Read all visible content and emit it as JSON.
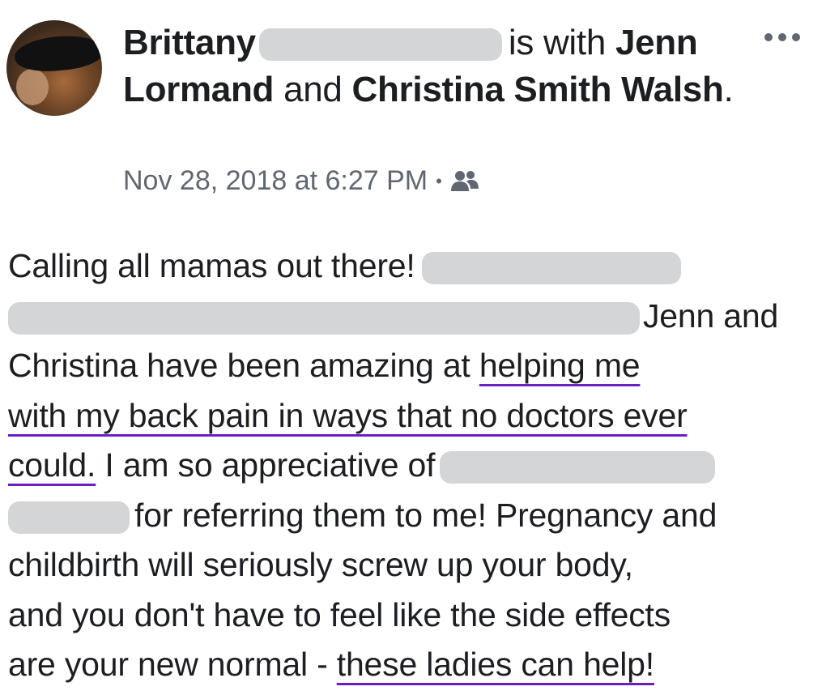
{
  "post": {
    "author_first": "Brittany",
    "is_with": "is with",
    "tagged_1_part1": "Jenn",
    "tagged_1_part2": "Lormand",
    "and": "and",
    "tagged_2_part1": "Christina Smith",
    "tagged_2_part2": "Walsh",
    "period": ".",
    "timestamp": "Nov 28, 2018 at 6:27 PM",
    "separator": "•",
    "privacy_icon": "friends-icon",
    "more_icon": "more-options-icon"
  },
  "body": {
    "l1": "Calling all mamas out there!",
    "l2": "Jenn and",
    "l3a": "Christina have been amazing at ",
    "l3b": "helping me",
    "l4": "with my back pain in ways that no doctors ever",
    "l5a": "could.",
    "l5b": " I am so appreciative of",
    "l6": "for referring them to me! Pregnancy and",
    "l7": "childbirth will seriously screw up your body,",
    "l8": "and you don't have to feel like the side effects",
    "l9a": "are your new normal - ",
    "l9b": "these ladies can help!"
  },
  "colors": {
    "underline": "#6a1fc0",
    "redaction": "#d4d5d7",
    "meta_text": "#606770"
  }
}
